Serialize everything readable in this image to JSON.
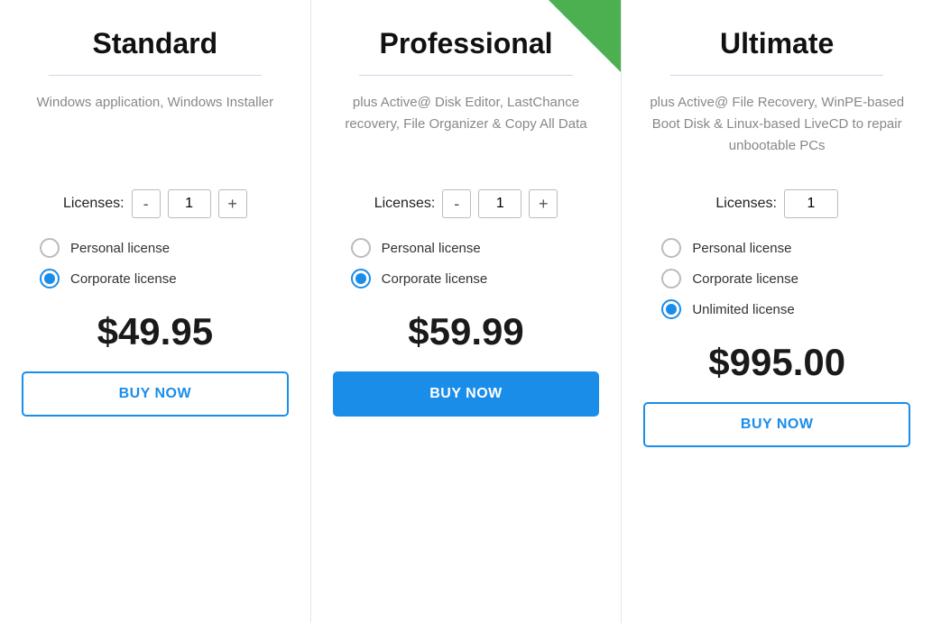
{
  "plans": [
    {
      "id": "standard",
      "title": "Standard",
      "description": "Windows application, Windows Installer",
      "has_ribbon": false,
      "licenses": {
        "show_stepper": true,
        "default_value": "1"
      },
      "license_types": [
        {
          "label": "Personal license",
          "selected": false
        },
        {
          "label": "Corporate license",
          "selected": true
        }
      ],
      "price": "$49.95",
      "buy_label": "BUY NOW",
      "buy_style": "outline"
    },
    {
      "id": "professional",
      "title": "Professional",
      "description": "plus Active@ Disk Editor, LastChance recovery, File Organizer & Copy All Data",
      "has_ribbon": true,
      "licenses": {
        "show_stepper": true,
        "default_value": "1"
      },
      "license_types": [
        {
          "label": "Personal license",
          "selected": false
        },
        {
          "label": "Corporate license",
          "selected": true
        }
      ],
      "price": "$59.99",
      "buy_label": "BUY NOW",
      "buy_style": "filled"
    },
    {
      "id": "ultimate",
      "title": "Ultimate",
      "description": "plus Active@ File Recovery, WinPE-based Boot Disk & Linux-based LiveCD to repair unbootable PCs",
      "has_ribbon": false,
      "licenses": {
        "show_stepper": false,
        "default_value": "1"
      },
      "license_types": [
        {
          "label": "Personal license",
          "selected": false
        },
        {
          "label": "Corporate license",
          "selected": false
        },
        {
          "label": "Unlimited license",
          "selected": true
        }
      ],
      "price": "$995.00",
      "buy_label": "BUY NOW",
      "buy_style": "outline"
    }
  ],
  "licenses_label": "Licenses:"
}
